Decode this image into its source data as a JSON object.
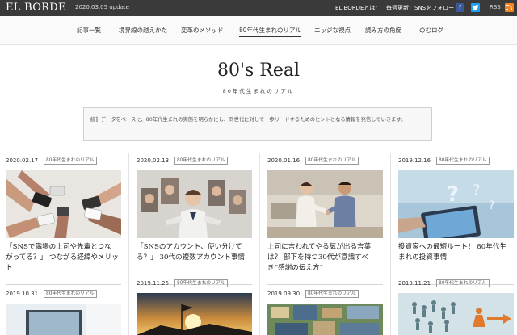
{
  "header": {
    "logo": "EL BORDE",
    "update": "2020.03.05 update",
    "about_label": "EL BORDEとは",
    "about_arrow": "›",
    "follow_label": "毎週更新！SNSをフォロー",
    "facebook_glyph": "f",
    "twitter_glyph": "t",
    "rss_label": "RSS"
  },
  "nav": {
    "items": [
      {
        "label": "記事一覧"
      },
      {
        "label": "境界線の越えかた"
      },
      {
        "label": "変革のメソッド"
      },
      {
        "label": "80年代生まれのリアル",
        "active": true
      },
      {
        "label": "エッジな視点"
      },
      {
        "label": "読み方の角度"
      },
      {
        "label": "のむログ"
      }
    ]
  },
  "hero": {
    "title": "80's Real",
    "subtitle": "80年代生まれのリアル",
    "description": "統計データをベースに、80年代生まれの実態を明らかにし、同世代に対して一歩リードするためのヒントとなる情報を発信していきます。"
  },
  "articles": [
    {
      "date": "2020.02.17",
      "tag": "80年代生まれのリアル",
      "title_lines": [
        "「SNSで職場の上司や先輩とつな",
        "がってる？」 つながる経緯やメリット"
      ],
      "image": "hands-with-phones-photo"
    },
    {
      "date": "2020.02.13",
      "tag": "80年代生まれのリアル",
      "title_lines": [
        "「SNSのアカウント、使い分けて",
        "る？」 30代の複数アカウント事情"
      ],
      "image": "many-faces-photo"
    },
    {
      "date": "2020.01.16",
      "tag": "80年代生まれのリアル",
      "title_lines": [
        "上司に言われてやる気が出る言葉",
        "は？ 部下を持つ30代が意識すべ",
        "き“感謝の伝え方”"
      ],
      "image": "handshake-office-photo"
    },
    {
      "date": "2019.12.16",
      "tag": "80年代生まれのリアル",
      "title_lines": [
        "投資家への最短ルート！ 80年代生",
        "まれの投資事情"
      ],
      "image": "tablet-question-marks-photo"
    },
    {
      "date": "2019.10.31",
      "tag": "80年代生まれのリアル",
      "title_lines": [],
      "image": "laptop-window-photo"
    },
    {
      "date": "2019.11.25",
      "tag": "80年代生まれのリアル",
      "title_lines": [],
      "image": "sunset-flag-photo"
    },
    {
      "date": "2019.09.30",
      "tag": "80年代生まれのリアル",
      "title_lines": [],
      "image": "city-aerial-photo"
    },
    {
      "date": "2019.11.21",
      "tag": "80年代生まれのリアル",
      "title_lines": [],
      "image": "figures-arrow-photo"
    }
  ]
}
